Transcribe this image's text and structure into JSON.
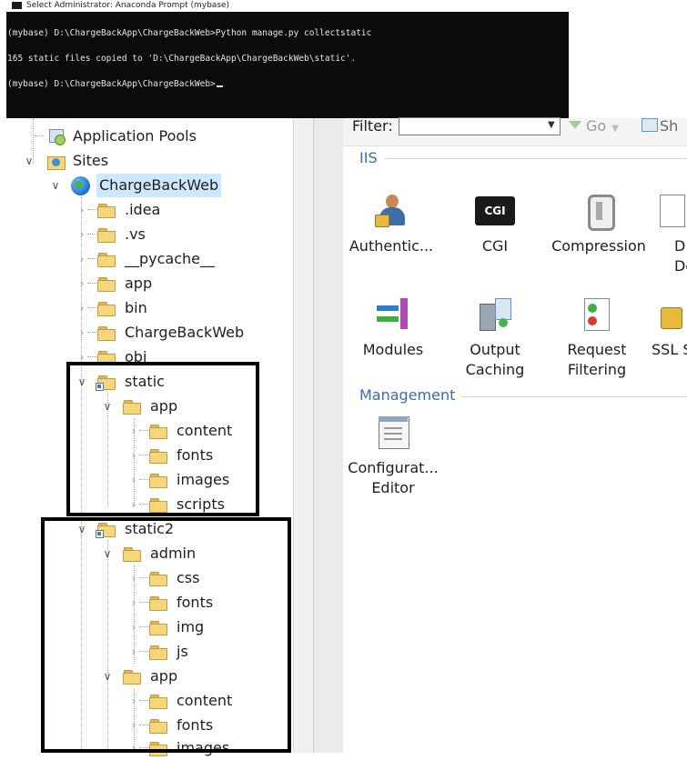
{
  "console": {
    "title": "Select Administrator: Anaconda Prompt (mybase)",
    "lines": [
      "(mybase) D:\\ChargeBackApp\\ChargeBackWeb>Python manage.py collectstatic",
      "165 static files copied to 'D:\\ChargeBackApp\\ChargeBackWeb\\static'.",
      "(mybase) D:\\ChargeBackApp\\ChargeBackWeb>"
    ]
  },
  "tree": {
    "application_pools": "Application Pools",
    "sites": "Sites",
    "site": "ChargeBackWeb",
    "folders": [
      ".idea",
      ".vs",
      "__pycache__",
      "app",
      "bin",
      "ChargeBackWeb",
      "obj"
    ],
    "static": {
      "label": "static",
      "app": "app",
      "app_children": [
        "content",
        "fonts",
        "images",
        "scripts"
      ]
    },
    "static2": {
      "label": "static2",
      "admin": "admin",
      "admin_children": [
        "css",
        "fonts",
        "img",
        "js"
      ],
      "app": "app",
      "app_children": [
        "content",
        "fonts",
        "images"
      ]
    }
  },
  "features": {
    "filter_label": "Filter:",
    "go_label": "Go",
    "show_label": "Sh",
    "iis_group": "IIS",
    "management_group": "Management",
    "iis_items": [
      {
        "label": "Authentic...",
        "icon": "authentication-icon"
      },
      {
        "label": "CGI",
        "icon": "cgi-icon"
      },
      {
        "label": "Compression",
        "icon": "compression-icon"
      },
      {
        "label": "D\nDoc",
        "icon": "default-document-icon"
      },
      {
        "label": "Modules",
        "icon": "modules-icon"
      },
      {
        "label": "Output\nCaching",
        "icon": "output-caching-icon"
      },
      {
        "label": "Request\nFiltering",
        "icon": "request-filtering-icon"
      },
      {
        "label": "SSL S",
        "icon": "ssl-settings-icon"
      }
    ],
    "management_items": [
      {
        "label": "Configurat...\nEditor",
        "icon": "configuration-editor-icon"
      }
    ]
  }
}
